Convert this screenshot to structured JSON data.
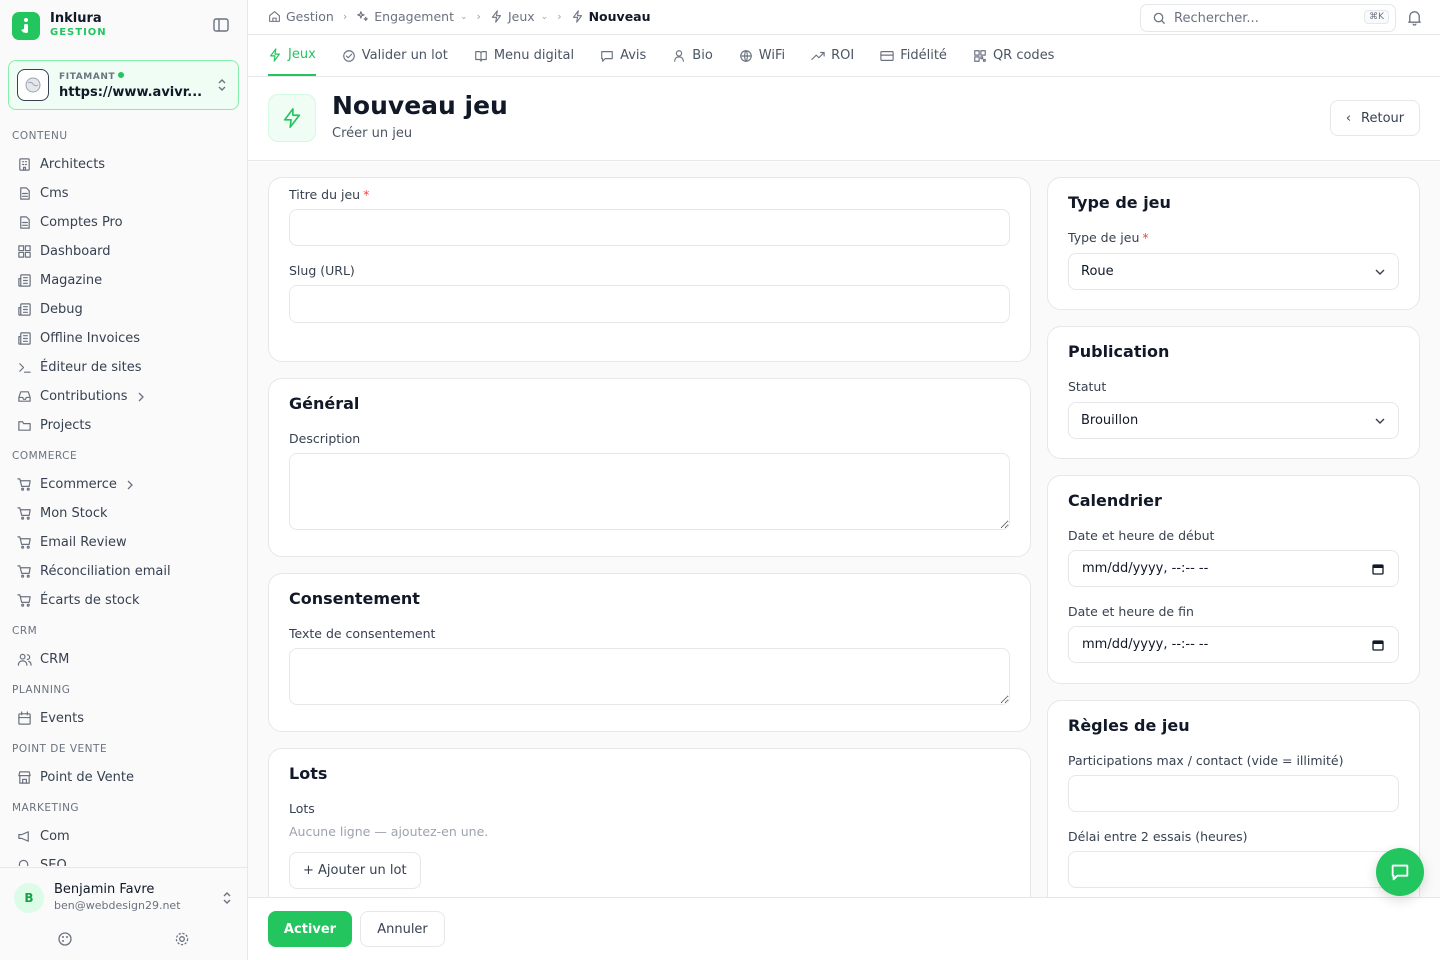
{
  "app": {
    "name": "Inklura",
    "subtitle": "GESTION"
  },
  "site": {
    "label": "FITAMANT",
    "url": "https://www.avivr..."
  },
  "sidebar": {
    "sections": [
      {
        "title": "CONTENU",
        "items": [
          {
            "label": "Architects",
            "icon": "building-icon"
          },
          {
            "label": "Cms",
            "icon": "file-icon"
          },
          {
            "label": "Comptes Pro",
            "icon": "file-icon"
          },
          {
            "label": "Dashboard",
            "icon": "grid-icon"
          },
          {
            "label": "Magazine",
            "icon": "newspaper-icon"
          },
          {
            "label": "Debug",
            "icon": "newspaper-icon"
          },
          {
            "label": "Offline Invoices",
            "icon": "newspaper-icon"
          },
          {
            "label": "Éditeur de sites",
            "icon": "terminal-icon"
          },
          {
            "label": "Contributions",
            "icon": "inbox-icon",
            "has_children": true
          },
          {
            "label": "Projects",
            "icon": "folder-icon"
          }
        ]
      },
      {
        "title": "COMMERCE",
        "items": [
          {
            "label": "Ecommerce",
            "icon": "cart-icon",
            "has_children": true
          },
          {
            "label": "Mon Stock",
            "icon": "cart-icon"
          },
          {
            "label": "Email Review",
            "icon": "cart-icon"
          },
          {
            "label": "Réconciliation email",
            "icon": "cart-icon"
          },
          {
            "label": "Écarts de stock",
            "icon": "cart-icon"
          }
        ]
      },
      {
        "title": "CRM",
        "items": [
          {
            "label": "CRM",
            "icon": "users-icon"
          }
        ]
      },
      {
        "title": "PLANNING",
        "items": [
          {
            "label": "Events",
            "icon": "calendar-icon"
          }
        ]
      },
      {
        "title": "POINT DE VENTE",
        "items": [
          {
            "label": "Point de Vente",
            "icon": "store-icon"
          }
        ]
      },
      {
        "title": "MARKETING",
        "items": [
          {
            "label": "Com",
            "icon": "megaphone-icon"
          },
          {
            "label": "SEO",
            "icon": "search-icon"
          }
        ]
      }
    ]
  },
  "user": {
    "initial": "B",
    "name": "Benjamin Favre",
    "email": "ben@webdesign29.net"
  },
  "breadcrumb": {
    "items": [
      {
        "label": "Gestion",
        "icon": "home-icon",
        "dropdown": false
      },
      {
        "label": "Engagement",
        "icon": "sparkles-icon",
        "dropdown": true
      },
      {
        "label": "Jeux",
        "icon": "zap-icon",
        "dropdown": true
      },
      {
        "label": "Nouveau",
        "icon": "zap-icon",
        "dropdown": false,
        "current": true
      }
    ]
  },
  "search": {
    "placeholder": "Rechercher...",
    "shortcut": "⌘K"
  },
  "tabs": [
    {
      "label": "Jeux",
      "icon": "zap-icon",
      "active": true
    },
    {
      "label": "Valider un lot",
      "icon": "check-circle-icon"
    },
    {
      "label": "Menu digital",
      "icon": "book-icon"
    },
    {
      "label": "Avis",
      "icon": "message-icon"
    },
    {
      "label": "Bio",
      "icon": "user-icon"
    },
    {
      "label": "WiFi",
      "icon": "globe-icon"
    },
    {
      "label": "ROI",
      "icon": "trending-icon"
    },
    {
      "label": "Fidélité",
      "icon": "card-icon"
    },
    {
      "label": "QR codes",
      "icon": "qr-icon"
    }
  ],
  "page": {
    "title": "Nouveau jeu",
    "subtitle": "Créer un jeu",
    "back_label": "Retour"
  },
  "form": {
    "title_label": "Titre du jeu",
    "title_value": "",
    "slug_label": "Slug (URL)",
    "slug_value": "",
    "general": {
      "title": "Général",
      "description_label": "Description",
      "description_value": ""
    },
    "consent": {
      "title": "Consentement",
      "text_label": "Texte de consentement",
      "text_value": ""
    },
    "lots": {
      "title": "Lots",
      "label": "Lots",
      "empty": "Aucune ligne — ajoutez-en une.",
      "add_label": "+ Ajouter un lot"
    },
    "game_type": {
      "title": "Type de jeu",
      "label": "Type de jeu",
      "value": "Roue"
    },
    "publication": {
      "title": "Publication",
      "label": "Statut",
      "value": "Brouillon"
    },
    "calendar": {
      "title": "Calendrier",
      "start_label": "Date et heure de début",
      "start_value": "mm/dd/yyyy, --:-- --",
      "end_label": "Date et heure de fin",
      "end_value": "mm/dd/yyyy, --:-- --"
    },
    "rules": {
      "title": "Règles de jeu",
      "max_label": "Participations max / contact (vide = illimité)",
      "max_value": "",
      "delay_label": "Délai entre 2 essais (heures)",
      "delay_value": ""
    }
  },
  "footer": {
    "activate_label": "Activer",
    "cancel_label": "Annuler"
  },
  "colors": {
    "accent": "#22c55e",
    "required": "#ef4444"
  }
}
